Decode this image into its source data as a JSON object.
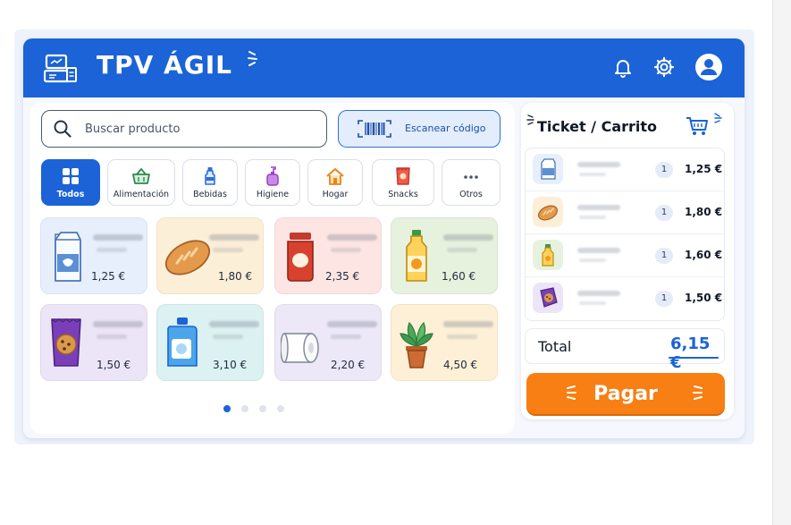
{
  "header": {
    "title": "TPV ÁGIL"
  },
  "search": {
    "placeholder": "Buscar producto"
  },
  "scan": {
    "label": "Escanear código"
  },
  "categories": [
    {
      "label": "Todos",
      "icon": "grid-icon",
      "active": true
    },
    {
      "label": "Alimentación",
      "icon": "basket-icon"
    },
    {
      "label": "Bebidas",
      "icon": "bottle-icon"
    },
    {
      "label": "Higiene",
      "icon": "soap-icon"
    },
    {
      "label": "Hogar",
      "icon": "house-icon"
    },
    {
      "label": "Snacks",
      "icon": "chips-bag-icon"
    },
    {
      "label": "Otros",
      "icon": "more-dots-icon"
    }
  ],
  "products": [
    {
      "icon": "milk-carton-icon",
      "price": "1,25 €",
      "bg": "#e6effb"
    },
    {
      "icon": "bread-icon",
      "price": "1,80 €",
      "bg": "#fcefd8"
    },
    {
      "icon": "jam-jar-icon",
      "price": "2,35 €",
      "bg": "#fde5e3"
    },
    {
      "icon": "juice-bottle-icon",
      "price": "1,60 €",
      "bg": "#e7f2de"
    },
    {
      "icon": "cookies-bag-icon",
      "price": "1,50 €",
      "bg": "#ece5f7"
    },
    {
      "icon": "detergent-icon",
      "price": "3,10 €",
      "bg": "#dcf1f1"
    },
    {
      "icon": "toilet-paper-icon",
      "price": "2,20 €",
      "bg": "#ece8f7"
    },
    {
      "icon": "potted-plant-icon",
      "price": "4,50 €",
      "bg": "#fdf0d6"
    }
  ],
  "pagination": {
    "pages": 4,
    "current": 1
  },
  "cart": {
    "title": "Ticket / Carrito",
    "items": [
      {
        "icon": "milk-carton-icon",
        "qty": "1",
        "price": "1,25 €",
        "bg": "#e6effb"
      },
      {
        "icon": "bread-icon",
        "qty": "1",
        "price": "1,80 €",
        "bg": "#fcefd8"
      },
      {
        "icon": "juice-bottle-icon",
        "qty": "1",
        "price": "1,60 €",
        "bg": "#e7f2de"
      },
      {
        "icon": "cookies-bag-icon",
        "qty": "1",
        "price": "1,50 €",
        "bg": "#ece5f7"
      }
    ],
    "total_label": "Total",
    "total_value": "6,15 €",
    "pay_label": "Pagar"
  },
  "colors": {
    "primary": "#1b63d6",
    "accent": "#f77f13"
  }
}
